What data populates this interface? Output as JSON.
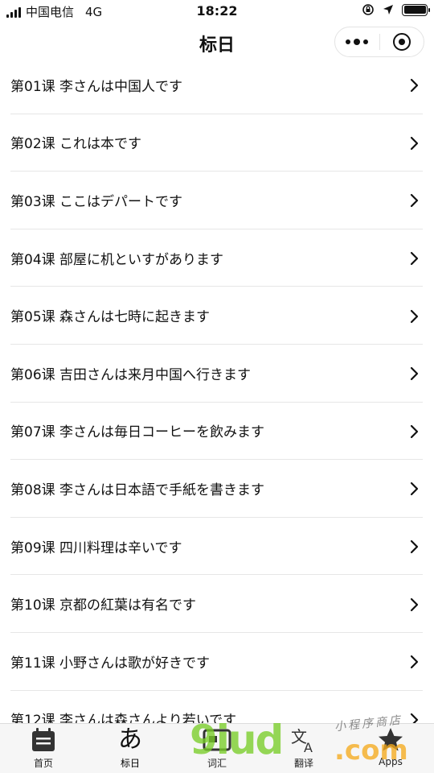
{
  "status_bar": {
    "carrier": "中国电信",
    "network": "4G",
    "time": "18:22"
  },
  "nav": {
    "title": "标日"
  },
  "lessons": [
    {
      "label": "第01课 李さんは中国人です"
    },
    {
      "label": "第02课 これは本です"
    },
    {
      "label": "第03课 ここはデパートです"
    },
    {
      "label": "第04课 部屋に机といすがあります"
    },
    {
      "label": "第05课 森さんは七時に起きます"
    },
    {
      "label": "第06课 吉田さんは来月中国へ行きます"
    },
    {
      "label": "第07课 李さんは毎日コーヒーを飲みます"
    },
    {
      "label": "第08课 李さんは日本語で手紙を書きます"
    },
    {
      "label": "第09课 四川料理は辛いです"
    },
    {
      "label": "第10课 京都の紅葉は有名です"
    },
    {
      "label": "第11课 小野さんは歌が好きです"
    },
    {
      "label": "第12课 李さんは森さんより若いです"
    }
  ],
  "tabbar": {
    "tabs": [
      {
        "label": "首页",
        "icon": "calendar-icon"
      },
      {
        "label": "标日",
        "icon_text": "あ"
      },
      {
        "label": "词汇",
        "icon": "card-icon"
      },
      {
        "label": "翻译",
        "icon": "translate-icon",
        "icon_text": "文"
      },
      {
        "label": "Apps",
        "icon": "star-icon"
      }
    ]
  },
  "watermark": {
    "text": "9iud",
    "suffix": ".com",
    "tagline": "小程序商店"
  }
}
